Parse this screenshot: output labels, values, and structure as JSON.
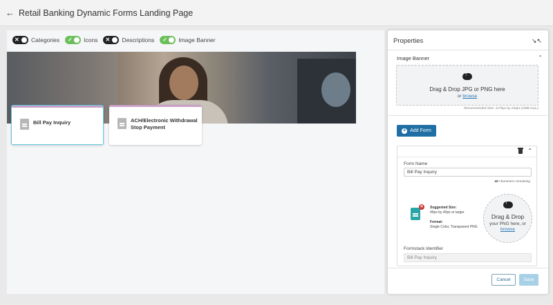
{
  "header": {
    "title": "Retail Banking Dynamic Forms Landing Page"
  },
  "toggles": [
    {
      "label": "Categories",
      "state": "off"
    },
    {
      "label": "Icons",
      "state": "on"
    },
    {
      "label": "Descriptions",
      "state": "off"
    },
    {
      "label": "Image Banner",
      "state": "on"
    }
  ],
  "cards": [
    {
      "label": "Bill Pay Inquiry",
      "selected": true
    },
    {
      "label": "ACH/Electronic Withdrawal Stop Payment",
      "selected": false
    }
  ],
  "properties": {
    "title": "Properties",
    "image_banner": {
      "title": "Image Banner",
      "drop_text": "Drag & Drop JPG or PNG here",
      "or_text": "or",
      "browse_text": "browse",
      "recommended": "Recommended Size: 1175px by 234px (2MB max.)"
    },
    "add_form_label": "Add Form",
    "form": {
      "name_label": "Form Name",
      "name_value": "Bill Pay Inquiry",
      "remaining_count": "42",
      "remaining_text": "characters remaining",
      "suggested_size_label": "Suggested Size:",
      "suggested_size_value": "40px by 40px or larger",
      "format_label": "Format:",
      "format_value": "Single Color, Transparent PNG",
      "drop_title": "Drag & Drop",
      "drop_line2": "your PNG here, or",
      "browse_text": "browse",
      "identifier_label": "Formstack Identifier",
      "identifier_value": "Bill Pay Inquiry"
    },
    "cancel_label": "Cancel",
    "save_label": "Save"
  },
  "colors": {
    "toggle_on": "#6bbf5a",
    "toggle_off": "#222222",
    "primary": "#1f6fa5",
    "card_selected_border": "#5bc8e3",
    "card_top_accent": "#c99fc6",
    "form_icon": "#2aa5a5",
    "remove": "#c83232"
  }
}
